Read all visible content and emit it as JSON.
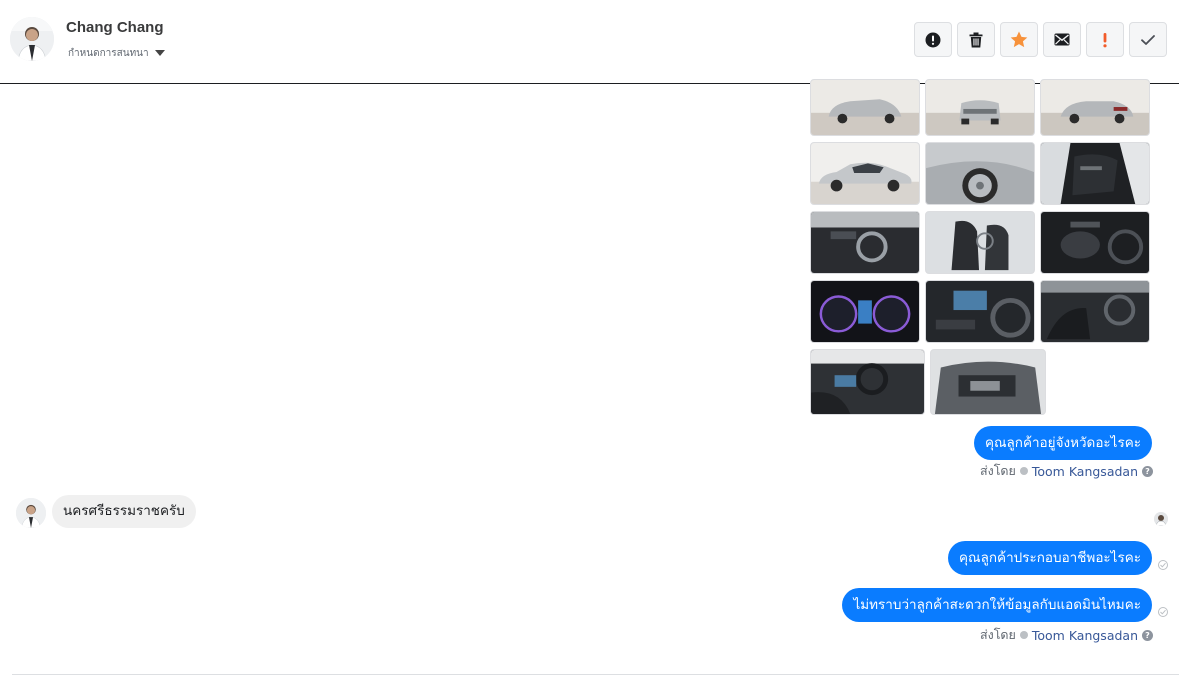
{
  "header": {
    "user_name": "Chang Chang",
    "conversation_status": "กำหนดการสนทนา",
    "toolbar": [
      {
        "name": "alert-button",
        "icon": "exclamation-circle-icon"
      },
      {
        "name": "delete-button",
        "icon": "trash-icon"
      },
      {
        "name": "star-button",
        "icon": "star-icon"
      },
      {
        "name": "mark-unread-button",
        "icon": "envelope-icon"
      },
      {
        "name": "spam-button",
        "icon": "exclamation-icon"
      },
      {
        "name": "done-button",
        "icon": "checkmark-icon"
      }
    ]
  },
  "thread": {
    "photo_album": {
      "photo_count": 14
    },
    "messages": [
      {
        "direction": "outgoing",
        "text": "คุณลูกค้าอยู่จังหวัดอะไรคะ"
      },
      {
        "direction": "incoming",
        "text": "นครศรีธรรมราชครับ"
      },
      {
        "direction": "outgoing",
        "text": "คุณลูกค้าประกอบอาชีพอะไรคะ"
      },
      {
        "direction": "outgoing",
        "text": "ไม่ทราบว่าลูกค้าสะดวกให้ข้อมูลกับแอดมินไหมคะ"
      }
    ],
    "sent_by": {
      "prefix": "ส่งโดย",
      "admin_name": "Toom Kangsadan",
      "help_glyph": "?"
    }
  },
  "colors": {
    "outgoing_bubble": "#0a7cff",
    "incoming_bubble": "#f0f0f0",
    "star": "#f7923b",
    "spam": "#f25c2a",
    "admin_name": "#385898"
  }
}
